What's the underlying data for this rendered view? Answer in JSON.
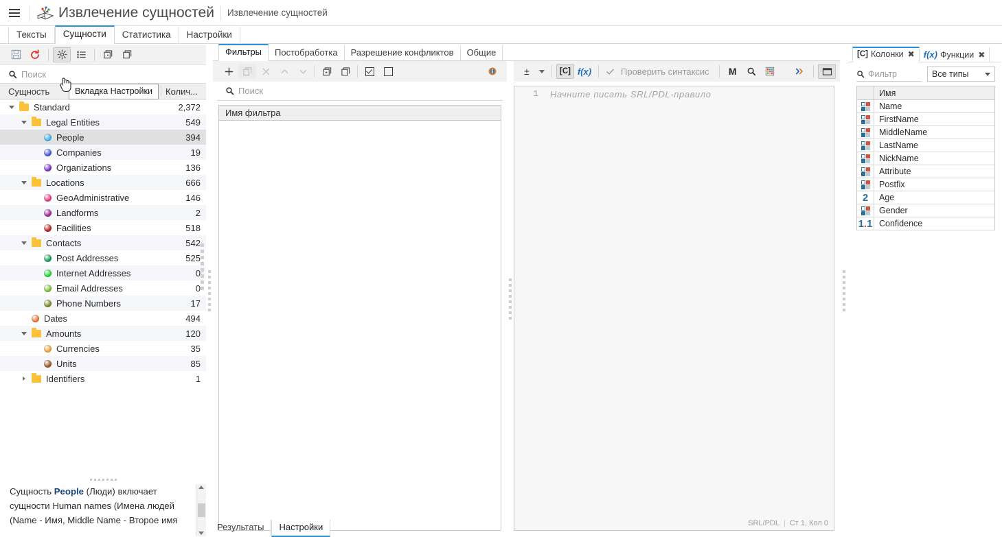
{
  "titlebar": {
    "menu_icon": "hamburger-menu-icon",
    "logo_icon": "app-logo-book-icon",
    "app_title": "Извлечение сущностей",
    "document_title": "Извлечение сущностей"
  },
  "main_tabs": [
    {
      "label": "Тексты",
      "active": false
    },
    {
      "label": "Сущности",
      "active": true
    },
    {
      "label": "Статистика",
      "active": false
    },
    {
      "label": "Настройки",
      "active": false
    }
  ],
  "left_panel": {
    "toolbar": [
      {
        "name": "save-button",
        "icon": "floppy-disk-icon",
        "pressed": false
      },
      {
        "name": "refresh-button",
        "icon": "refresh-circular-arrow-icon",
        "pressed": false
      },
      {
        "name": "settings-tab-button",
        "icon": "gear-icon",
        "pressed": true
      },
      {
        "name": "list-view-button",
        "icon": "list-icon",
        "pressed": false
      },
      {
        "name": "expand-all-button",
        "icon": "copy-expand-icon",
        "pressed": false
      },
      {
        "name": "collapse-all-button",
        "icon": "copy-collapse-icon",
        "pressed": false
      }
    ],
    "search_placeholder": "Поиск",
    "columns": {
      "entity": "Сущность",
      "count": "Колич..."
    },
    "tree": [
      {
        "label": "Standard",
        "count": "2,372",
        "indent": 0,
        "kind": "folder",
        "expanded": true,
        "selected": false
      },
      {
        "label": "Legal Entities",
        "count": "549",
        "indent": 1,
        "kind": "folder",
        "expanded": true,
        "selected": false
      },
      {
        "label": "People",
        "count": "394",
        "indent": 2,
        "kind": "dot",
        "color": "#3fb5ef",
        "selected": true
      },
      {
        "label": "Companies",
        "count": "19",
        "indent": 2,
        "kind": "dot",
        "color": "#4a57d8",
        "selected": false
      },
      {
        "label": "Organizations",
        "count": "136",
        "indent": 2,
        "kind": "dot",
        "color": "#7a2fc6",
        "selected": false
      },
      {
        "label": "Locations",
        "count": "666",
        "indent": 1,
        "kind": "folder",
        "expanded": true,
        "selected": false
      },
      {
        "label": "GeoAdministrative",
        "count": "146",
        "indent": 2,
        "kind": "dot",
        "color": "#ee3a7e",
        "selected": false
      },
      {
        "label": "Landforms",
        "count": "2",
        "indent": 2,
        "kind": "dot",
        "color": "#a0288e",
        "selected": false
      },
      {
        "label": "Facilities",
        "count": "518",
        "indent": 2,
        "kind": "dot",
        "color": "#bb1f22",
        "selected": false
      },
      {
        "label": "Contacts",
        "count": "542",
        "indent": 1,
        "kind": "folder",
        "expanded": true,
        "selected": false
      },
      {
        "label": "Post Addresses",
        "count": "525",
        "indent": 2,
        "kind": "dot",
        "color": "#16a05c",
        "selected": false
      },
      {
        "label": "Internet Addresses",
        "count": "0",
        "indent": 2,
        "kind": "dot",
        "color": "#27d53a",
        "selected": false
      },
      {
        "label": "Email Addresses",
        "count": "0",
        "indent": 2,
        "kind": "dot",
        "color": "#77c23a",
        "selected": false
      },
      {
        "label": "Phone Numbers",
        "count": "17",
        "indent": 2,
        "kind": "dot",
        "color": "#7d8a2c",
        "selected": false
      },
      {
        "label": "Dates",
        "count": "494",
        "indent": 1,
        "kind": "dot",
        "color": "#ef7537",
        "selected": false
      },
      {
        "label": "Amounts",
        "count": "120",
        "indent": 1,
        "kind": "folder",
        "expanded": true,
        "selected": false
      },
      {
        "label": "Currencies",
        "count": "35",
        "indent": 2,
        "kind": "dot",
        "color": "#f0a13c",
        "selected": false
      },
      {
        "label": "Units",
        "count": "85",
        "indent": 2,
        "kind": "dot",
        "color": "#9a5526",
        "selected": false
      },
      {
        "label": "Identifiers",
        "count": "1",
        "indent": 1,
        "kind": "folder",
        "expanded": false,
        "selected": false
      }
    ],
    "description_prefix": "Сущность ",
    "description_bold": "People",
    "description_rest": " (Люди) включает сущности Human names (Имена людей (Name - Имя, Middle Name - Второе имя"
  },
  "tooltip": {
    "text": "Вкладка Настройки"
  },
  "center_panel": {
    "tabs": [
      {
        "label": "Фильтры",
        "active": true
      },
      {
        "label": "Постобработка",
        "active": false
      },
      {
        "label": "Разрешение конфликтов",
        "active": false
      },
      {
        "label": "Общие",
        "active": false
      }
    ],
    "filters_toolbar": [
      {
        "name": "add-filter-button",
        "icon": "plus-icon",
        "enabled": true
      },
      {
        "name": "duplicate-filter-button",
        "icon": "copy-icon",
        "enabled": false
      },
      {
        "name": "delete-filter-button",
        "icon": "close-x-icon",
        "enabled": false
      },
      {
        "name": "move-up-button",
        "icon": "chevron-up-icon",
        "enabled": false
      },
      {
        "name": "move-down-button",
        "icon": "chevron-down-icon",
        "enabled": false
      },
      {
        "name": "import-filter-button",
        "icon": "import-box-icon",
        "enabled": true
      },
      {
        "name": "export-filter-button",
        "icon": "export-box-icon",
        "enabled": true
      },
      {
        "name": "check-all-button",
        "icon": "checkbox-checked-icon",
        "enabled": true
      },
      {
        "name": "uncheck-all-button",
        "icon": "checkbox-empty-icon",
        "enabled": true
      },
      {
        "name": "info-button",
        "icon": "info-circle-icon",
        "enabled": true
      }
    ],
    "filters_search_placeholder": "Поиск",
    "filters_list_header": "Имя фильтра",
    "editor_toolbar": {
      "collapse_label": "±",
      "constant_label": "[C]",
      "function_label": "f(x)",
      "check_syntax_label": "Проверить синтаксис",
      "macro_label": "M",
      "search_icon": "search-magnifier-icon",
      "palette_icon": "color-palette-grid-icon",
      "more_icon": "double-chevron-right-icon",
      "window_icon": "maximize-panel-icon"
    },
    "editor": {
      "line_number": "1",
      "placeholder": "Начните писать SRL/PDL-правило",
      "status_language": "SRL/PDL",
      "status_position": "Ст 1, Кол 0"
    }
  },
  "right_panel": {
    "tabs": [
      {
        "tag": "[C]",
        "label": "Колонки",
        "active": true,
        "close": "✖"
      },
      {
        "tag": "f(x)",
        "label": "Функции",
        "active": false,
        "close": "✖"
      }
    ],
    "filter_placeholder": "Фильтр",
    "type_select_value": "Все типы",
    "table_header_name": "Имя",
    "rows": [
      {
        "name": "Name",
        "type": "string"
      },
      {
        "name": "FirstName",
        "type": "string"
      },
      {
        "name": "MiddleName",
        "type": "string"
      },
      {
        "name": "LastName",
        "type": "string"
      },
      {
        "name": "NickName",
        "type": "string"
      },
      {
        "name": "Attribute",
        "type": "string"
      },
      {
        "name": "Postfix",
        "type": "string"
      },
      {
        "name": "Age",
        "type": "int",
        "glyph": "2"
      },
      {
        "name": "Gender",
        "type": "string"
      },
      {
        "name": "Confidence",
        "type": "float",
        "glyph": "1.1"
      }
    ]
  },
  "bottom_tabs": [
    {
      "label": "Результаты",
      "active": false
    },
    {
      "label": "Настройки",
      "active": true
    }
  ],
  "colors": {
    "accent": "#2d8fd5",
    "toolbar_bg": "#f2f2f2",
    "selection": "#e0e0e0",
    "alt_row": "#f5f6fa",
    "folder": "#fcc13b"
  }
}
